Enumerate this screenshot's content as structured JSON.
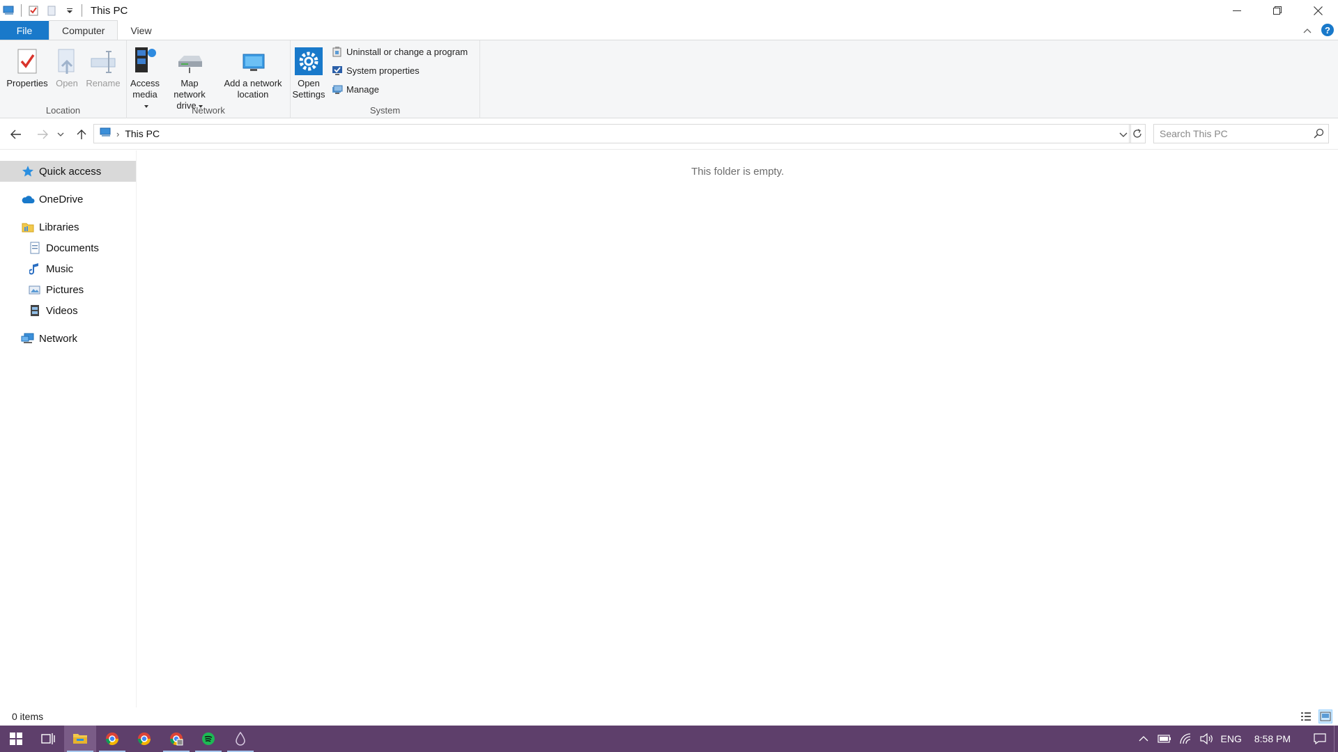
{
  "window": {
    "title": "This PC"
  },
  "ribbon_tabs": [
    {
      "label": "File"
    },
    {
      "label": "Computer"
    },
    {
      "label": "View"
    }
  ],
  "ribbon": {
    "location": {
      "label": "Location",
      "properties": "Properties",
      "open": "Open",
      "rename": "Rename"
    },
    "network": {
      "label": "Network",
      "access_media_1": "Access",
      "access_media_2": "media",
      "map_drive_1": "Map network",
      "map_drive_2": "drive",
      "add_location_1": "Add a network",
      "add_location_2": "location"
    },
    "system": {
      "label": "System",
      "open_settings_1": "Open",
      "open_settings_2": "Settings",
      "uninstall": "Uninstall or change a program",
      "system_properties": "System properties",
      "manage": "Manage"
    }
  },
  "address": {
    "path": "This PC",
    "search_placeholder": "Search This PC"
  },
  "nav_pane": {
    "quick_access": "Quick access",
    "onedrive": "OneDrive",
    "libraries": "Libraries",
    "documents": "Documents",
    "music": "Music",
    "pictures": "Pictures",
    "videos": "Videos",
    "network": "Network"
  },
  "content": {
    "empty_message": "This folder is empty."
  },
  "status": {
    "item_count": "0 items"
  },
  "taskbar": {
    "language": "ENG",
    "time": "8:58 PM"
  },
  "colors": {
    "accent": "#1979ca",
    "taskbar": "#5e3f6b",
    "selection": "#d9d9d9"
  }
}
